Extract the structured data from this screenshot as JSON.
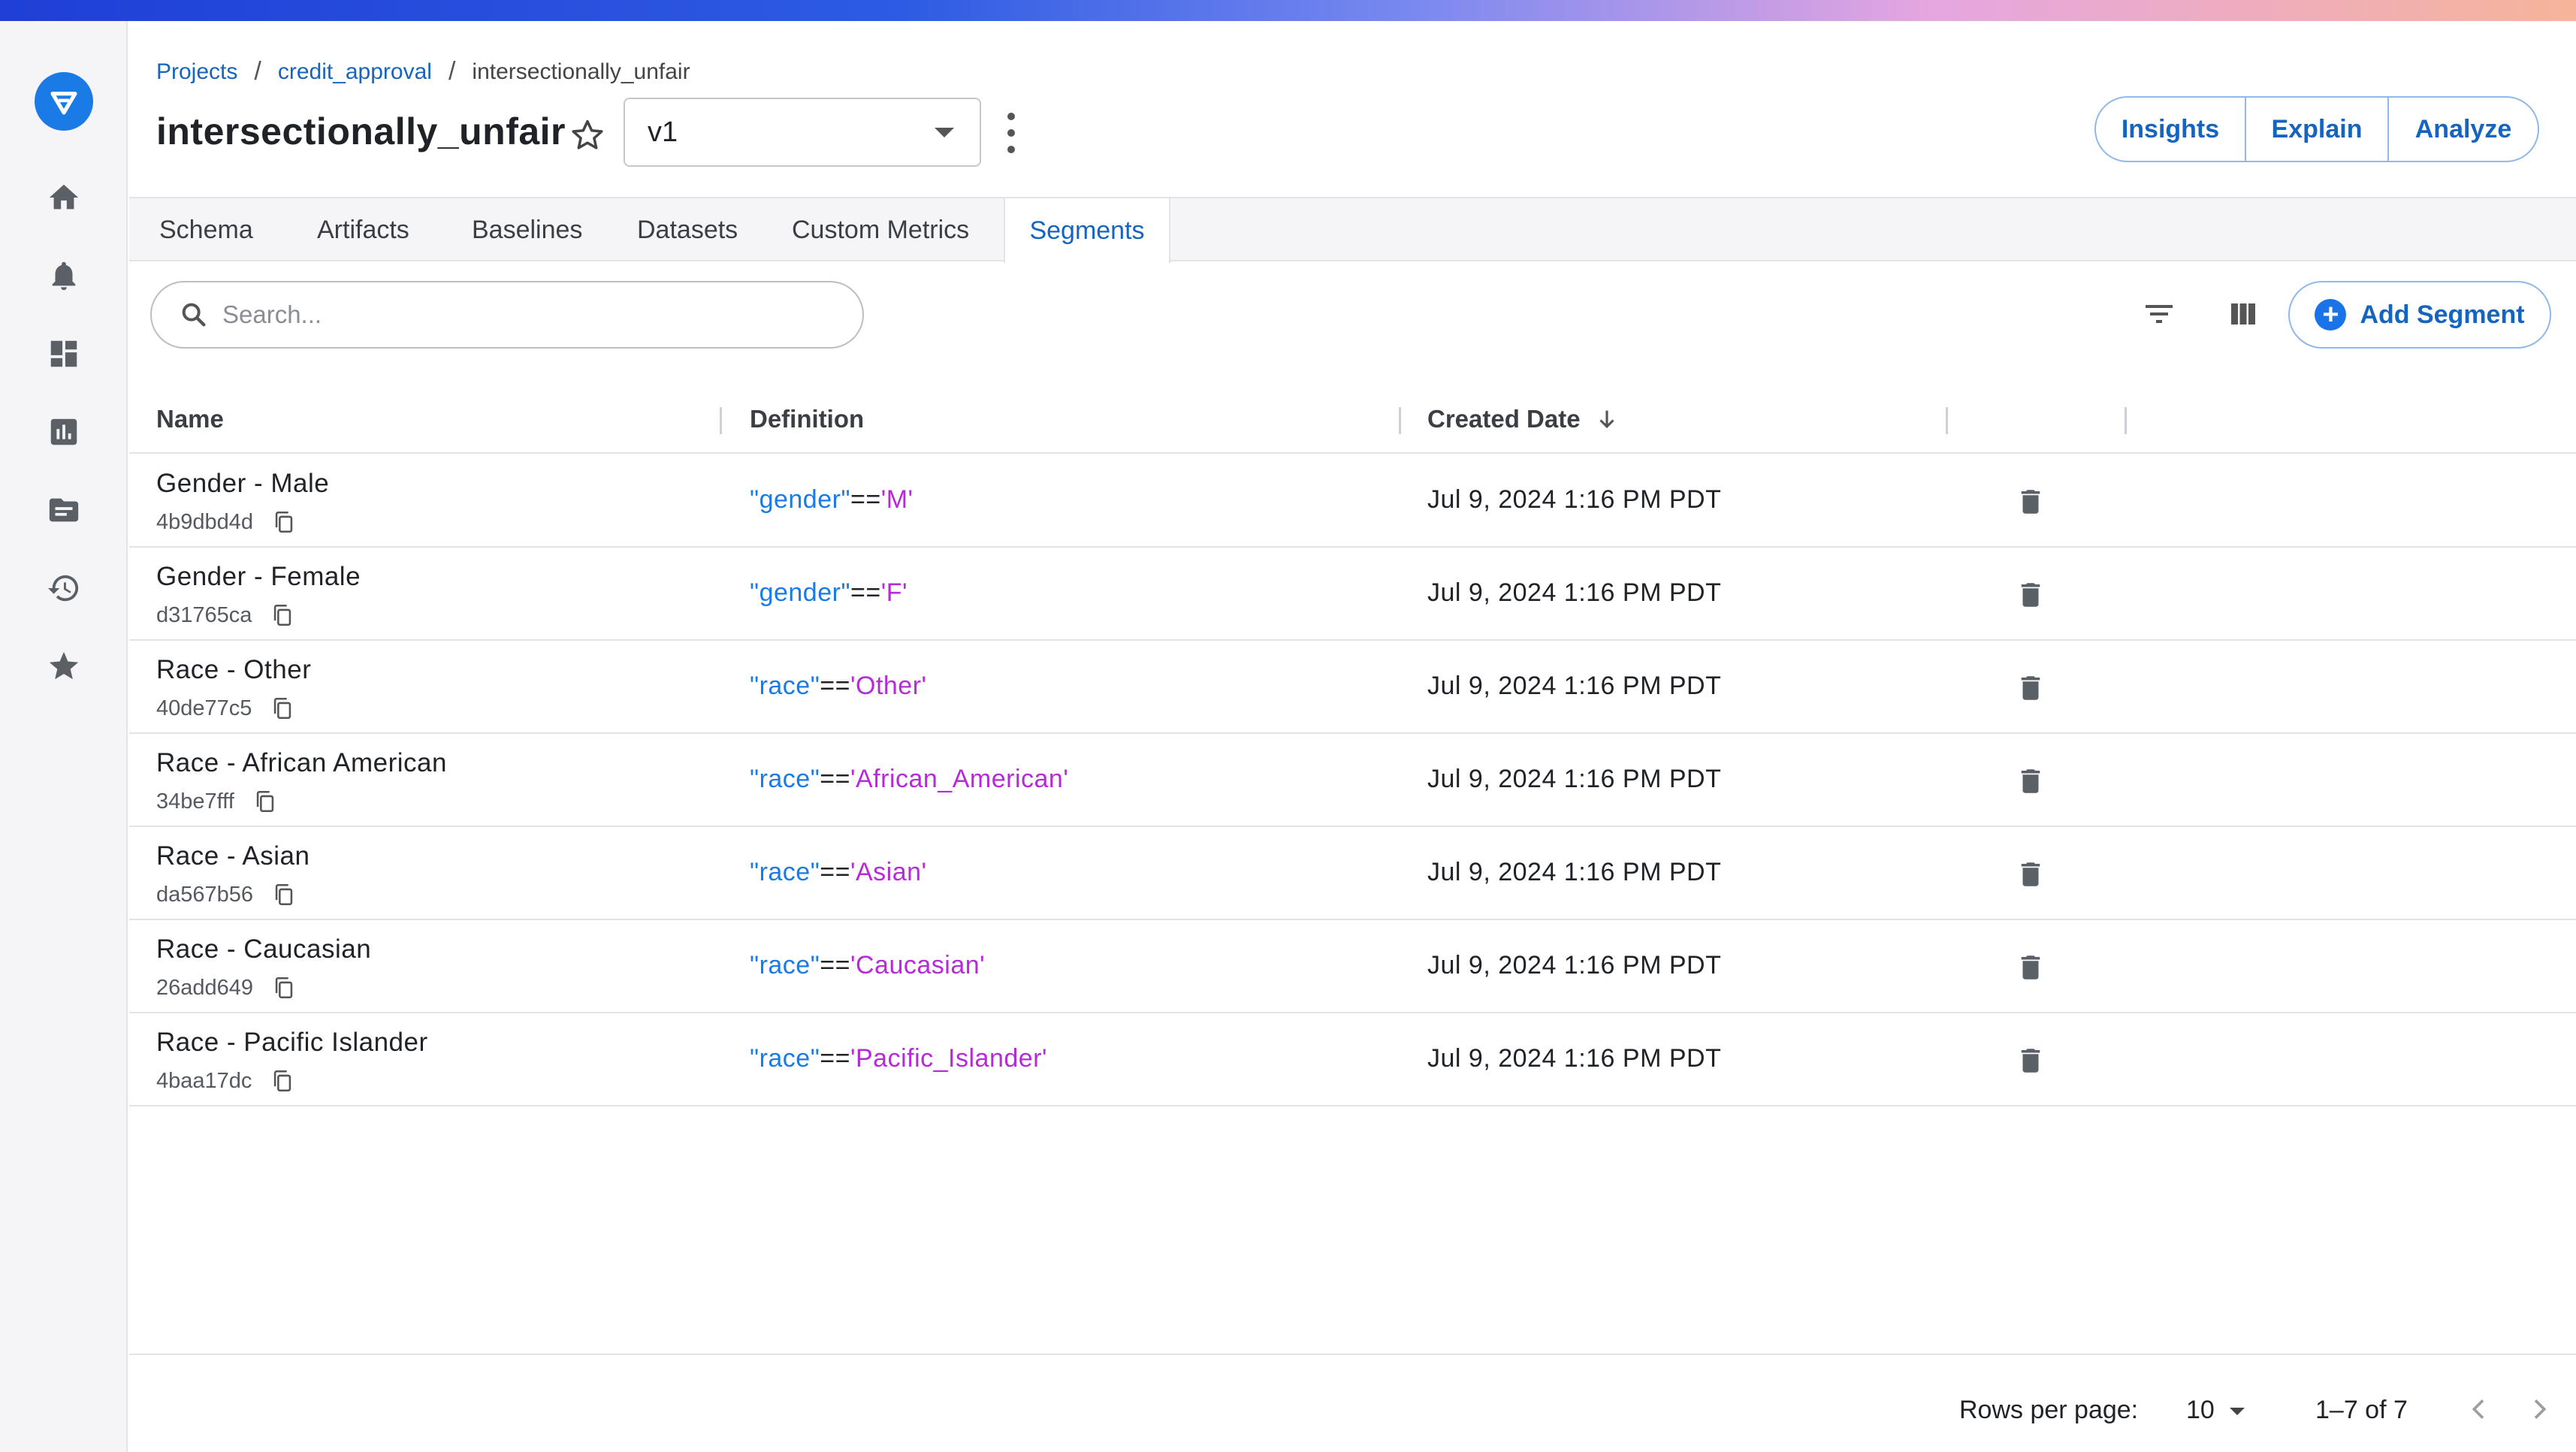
{
  "breadcrumb": {
    "projects": "Projects",
    "project": "credit_approval",
    "current": "intersectionally_unfair"
  },
  "model": {
    "title": "intersectionally_unfair",
    "version": "v1"
  },
  "actions": {
    "insights": "Insights",
    "explain": "Explain",
    "analyze": "Analyze"
  },
  "tabs": [
    "Schema",
    "Artifacts",
    "Baselines",
    "Datasets",
    "Custom Metrics",
    "Segments"
  ],
  "active_tab": "Segments",
  "search": {
    "placeholder": "Search..."
  },
  "add_segment_label": "Add Segment",
  "table": {
    "headers": {
      "name": "Name",
      "definition": "Definition",
      "created": "Created Date"
    },
    "rows": [
      {
        "name": "Gender - Male",
        "id": "4b9dbd4d",
        "key": "\"gender\"",
        "op": "==",
        "value": "'M'",
        "created": "Jul 9, 2024 1:16 PM PDT"
      },
      {
        "name": "Gender - Female",
        "id": "d31765ca",
        "key": "\"gender\"",
        "op": "==",
        "value": "'F'",
        "created": "Jul 9, 2024 1:16 PM PDT"
      },
      {
        "name": "Race - Other",
        "id": "40de77c5",
        "key": "\"race\"",
        "op": "==",
        "value": "'Other'",
        "created": "Jul 9, 2024 1:16 PM PDT"
      },
      {
        "name": "Race - African American",
        "id": "34be7fff",
        "key": "\"race\"",
        "op": "==",
        "value": "'African_American'",
        "created": "Jul 9, 2024 1:16 PM PDT"
      },
      {
        "name": "Race - Asian",
        "id": "da567b56",
        "key": "\"race\"",
        "op": "==",
        "value": "'Asian'",
        "created": "Jul 9, 2024 1:16 PM PDT"
      },
      {
        "name": "Race - Caucasian",
        "id": "26add649",
        "key": "\"race\"",
        "op": "==",
        "value": "'Caucasian'",
        "created": "Jul 9, 2024 1:16 PM PDT"
      },
      {
        "name": "Race - Pacific Islander",
        "id": "4baa17dc",
        "key": "\"race\"",
        "op": "==",
        "value": "'Pacific_Islander'",
        "created": "Jul 9, 2024 1:16 PM PDT"
      }
    ]
  },
  "pagination": {
    "rows_per_page_label": "Rows per page:",
    "rows_per_page": "10",
    "range": "1–7 of 7"
  },
  "sidebar_icons": [
    "home-icon",
    "bell-icon",
    "dashboard-icon",
    "chart-icon",
    "folder-icon",
    "history-icon",
    "star-icon"
  ],
  "colors": {
    "accent": "#1565c0",
    "key": "#1a7be6",
    "value": "#b62ad9",
    "logo": "#1a7be6"
  }
}
